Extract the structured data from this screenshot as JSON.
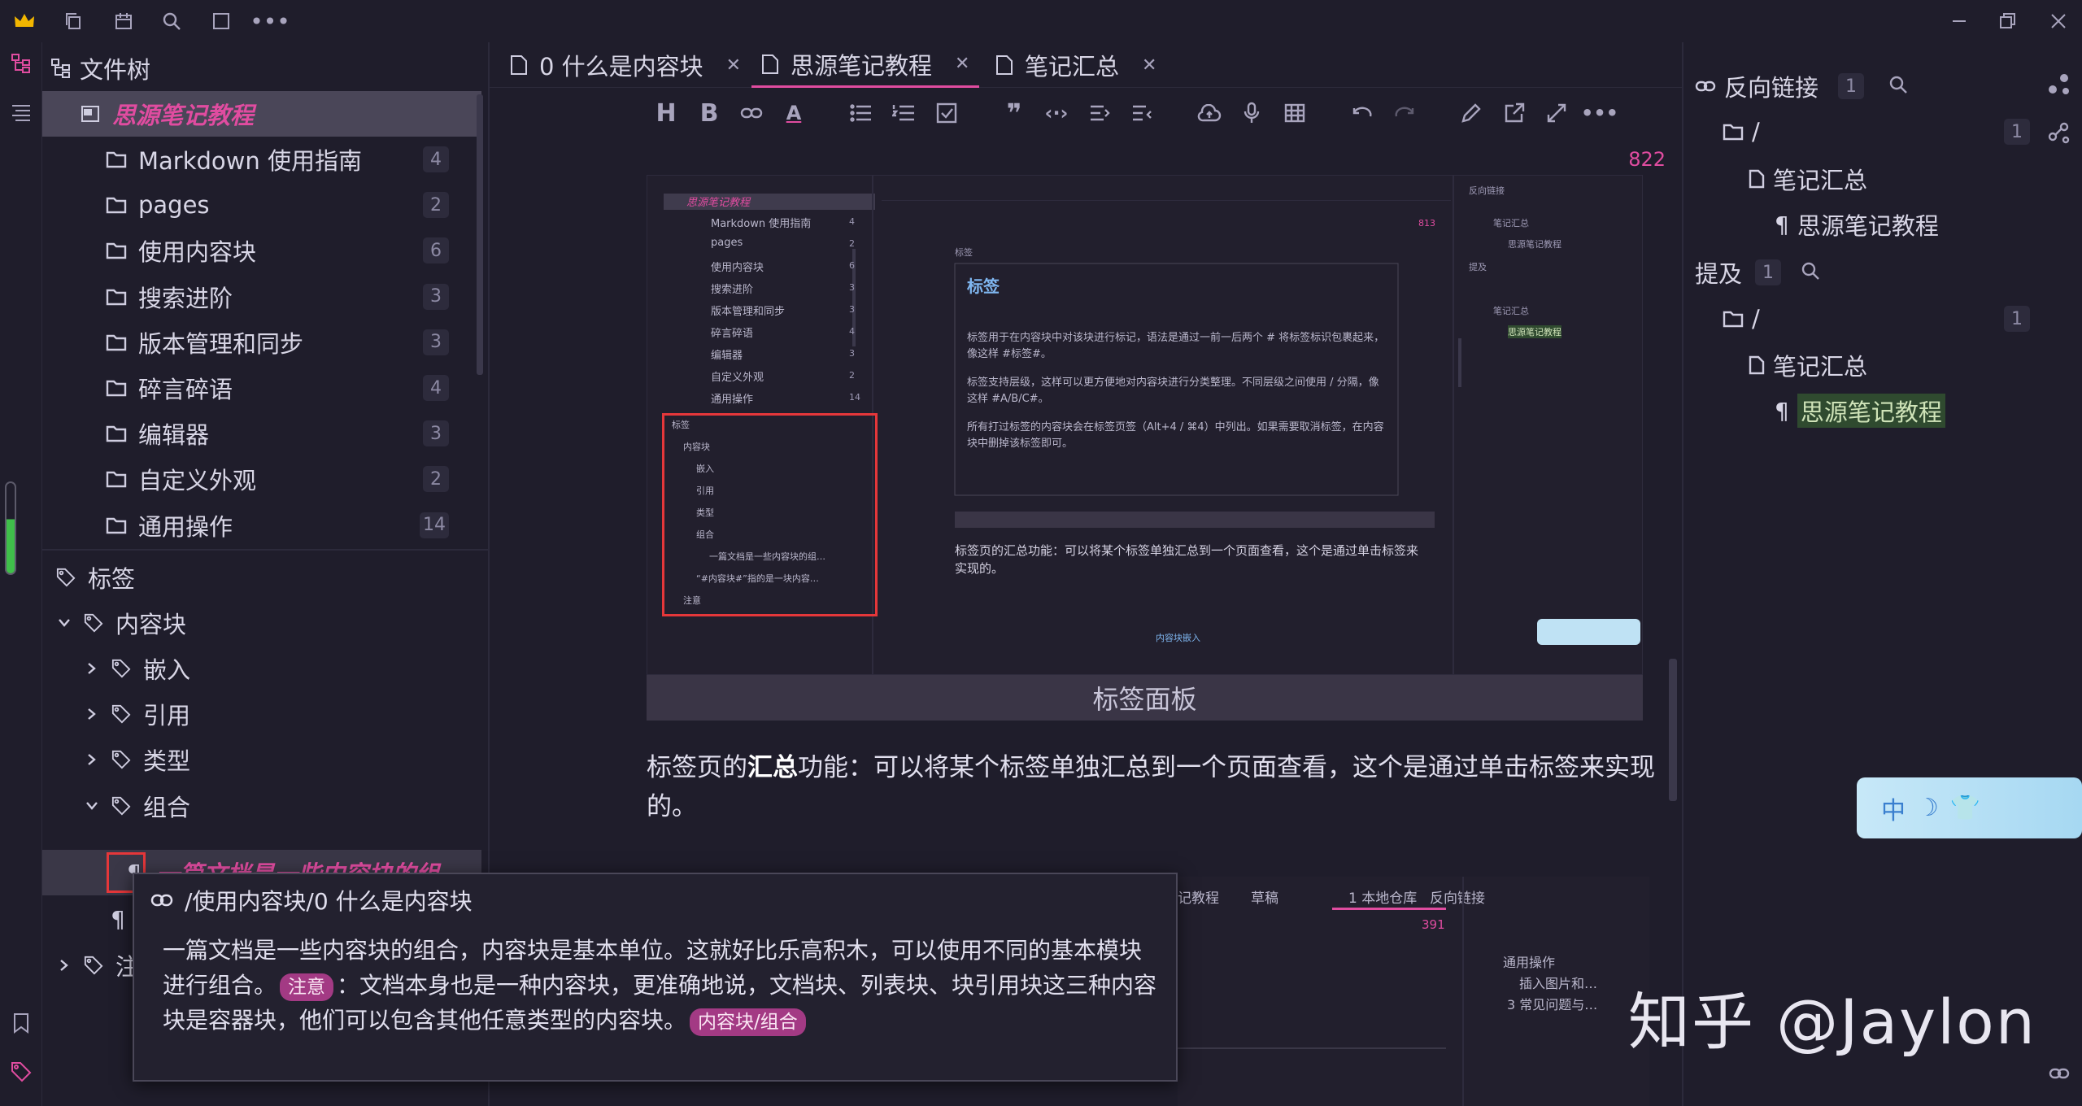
{
  "window": {
    "app_logo": "crown-icon"
  },
  "filetree": {
    "title": "文件树",
    "notebook": "思源笔记教程",
    "items": [
      {
        "label": "Markdown 使用指南",
        "count": "4"
      },
      {
        "label": "pages",
        "count": "2"
      },
      {
        "label": "使用内容块",
        "count": "6"
      },
      {
        "label": "搜索进阶",
        "count": "3"
      },
      {
        "label": "版本管理和同步",
        "count": "3"
      },
      {
        "label": "碎言碎语",
        "count": "4"
      },
      {
        "label": "编辑器",
        "count": "3"
      },
      {
        "label": "自定义外观",
        "count": "2"
      },
      {
        "label": "通用操作",
        "count": "14"
      }
    ]
  },
  "tags": {
    "title": "标签",
    "root": "内容块",
    "children": [
      "嵌入",
      "引用",
      "类型",
      "组合"
    ],
    "selected_block": "一篇文档是一些内容块的组…",
    "partial": "注"
  },
  "tabs": [
    {
      "label": "0 什么是内容块"
    },
    {
      "label": "思源笔记教程"
    },
    {
      "label": "笔记汇总"
    }
  ],
  "editor": {
    "word_count": "822",
    "caption": "标签面板",
    "para_pre": "标签页的",
    "para_bold": "汇总",
    "para_post": "功能：可以将某个标签单独汇总到一个页面查看，这个是通过单击标签来实现的。"
  },
  "inner": {
    "notebook": "思源笔记教程",
    "items": [
      {
        "label": "Markdown 使用指南",
        "count": "4"
      },
      {
        "label": "pages",
        "count": "2"
      },
      {
        "label": "使用内容块",
        "count": "6"
      },
      {
        "label": "搜索进阶",
        "count": "3"
      },
      {
        "label": "版本管理和同步",
        "count": "3"
      },
      {
        "label": "碎言碎语",
        "count": "4"
      },
      {
        "label": "编辑器",
        "count": "3"
      },
      {
        "label": "自定义外观",
        "count": "2"
      },
      {
        "label": "通用操作",
        "count": "14"
      }
    ],
    "tags": [
      "标签",
      "内容块",
      "嵌入",
      "引用",
      "类型",
      "组合",
      "一篇文档是一些内容块的组…",
      "“#内容块#”指的是一块内容…",
      "注意"
    ],
    "heading_small": "标签",
    "heading": "标签",
    "p1": "标签用于在内容块中对该块进行标记，语法是通过一前一后两个 # 将标签标识包裹起来，像这样 #标签#。",
    "p2": "标签支持层级，这样可以更方便地对内容块进行分类整理。不同层级之间使用 / 分隔，像这样 #A/B/C#。",
    "p3": "所有打过标签的内容块会在标签页签（Alt+4 / ⌘4）中列出。如果需要取消标签，在内容块中删掉该标签即可。",
    "p4": "标签页的汇总功能：可以将某个标签单独汇总到一个页面查看，这个是通过单击标签来实现的。",
    "count": "813",
    "rp": [
      "反向链接",
      "笔记汇总",
      "思源笔记教程",
      "提及",
      "笔记汇总",
      "思源笔记教程"
    ],
    "sub_tabs": [
      "记教程",
      "草稿",
      "1 本地仓库"
    ],
    "sub_rp": [
      "反向链接",
      "通用操作",
      "插入图片和…",
      "3 常见问题与…"
    ],
    "sub_count": "391",
    "sub_heading": "内容块嵌入"
  },
  "backlinks": {
    "title": "反向链接",
    "count": "1",
    "root": "/",
    "root_count": "1",
    "doc": "笔记汇总",
    "block": "思源笔记教程"
  },
  "mentions": {
    "title": "提及",
    "count": "1",
    "root": "/",
    "root_count": "1",
    "doc": "笔记汇总",
    "block": "思源笔记教程"
  },
  "popup": {
    "path": "/使用内容块/0 什么是内容块",
    "text1": "一篇文档是一些内容块的组合，内容块是基本单位。这就好比乐高积木，可以使用不同的基本模块进行组合。",
    "tag1": "注意",
    "text2": "：文档本身也是一种内容块，更准确地说，文档块、列表块、块引用块这三种内容块是容器块，他们可以包含其他任意类型的内容块。",
    "tag2": "内容块/组合"
  },
  "watermark": "知乎 @Jaylon",
  "deco": {
    "label": "中"
  },
  "colors": {
    "accent": "#e04ca0",
    "bg": "#1f1d2b",
    "highlight": "#2f4a2f",
    "redbox": "#e5373a"
  }
}
